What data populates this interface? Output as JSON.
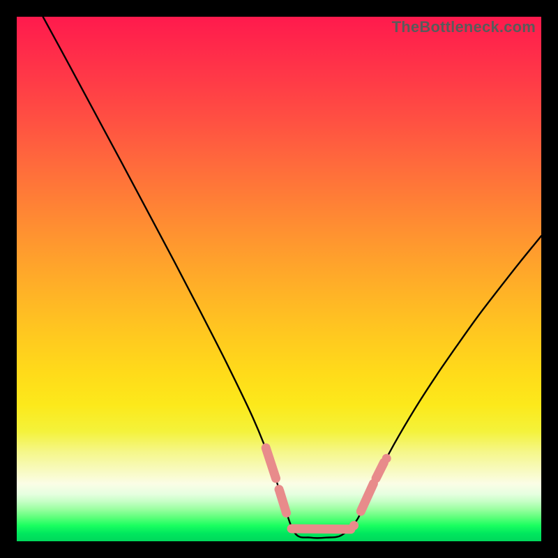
{
  "watermark": "TheBottleneck.com",
  "chart_data": {
    "type": "line",
    "title": "",
    "xlabel": "",
    "ylabel": "",
    "xlim": [
      0,
      100
    ],
    "ylim": [
      0,
      100
    ],
    "series": [
      {
        "name": "curve",
        "x": [
          5,
          10,
          15,
          20,
          25,
          30,
          35,
          40,
          45,
          48,
          50.5,
          53,
          56,
          59,
          62,
          65,
          68,
          72,
          76,
          80,
          84,
          88,
          92,
          96,
          100
        ],
        "y": [
          100,
          90.8,
          81.5,
          72.2,
          62.8,
          53.4,
          43.8,
          34.0,
          23.6,
          16.2,
          8.4,
          1.6,
          0.7,
          0.7,
          1.2,
          4.3,
          11.0,
          18.6,
          25.4,
          31.6,
          37.4,
          43.0,
          48.2,
          53.3,
          58.2
        ]
      }
    ],
    "markers": {
      "style": "segments+dots",
      "color": "#e88b8b",
      "segments": [
        {
          "x0": 47.5,
          "y0": 17.8,
          "x1": 49.4,
          "y1": 12.0
        },
        {
          "x0": 50.1,
          "y0": 9.6,
          "x1": 51.4,
          "y1": 5.4
        },
        {
          "x0": 52.4,
          "y0": 2.4,
          "x1": 63.7,
          "y1": 2.3
        },
        {
          "x0": 65.6,
          "y0": 5.7,
          "x1": 68.0,
          "y1": 11.0
        },
        {
          "x0": 68.5,
          "y0": 12.0,
          "x1": 70.0,
          "y1": 15.0
        }
      ],
      "dots": [
        {
          "x": 50.0,
          "y": 9.9
        },
        {
          "x": 64.3,
          "y": 3.0
        },
        {
          "x": 70.5,
          "y": 15.8
        }
      ]
    },
    "background": "red-to-green vertical gradient"
  }
}
